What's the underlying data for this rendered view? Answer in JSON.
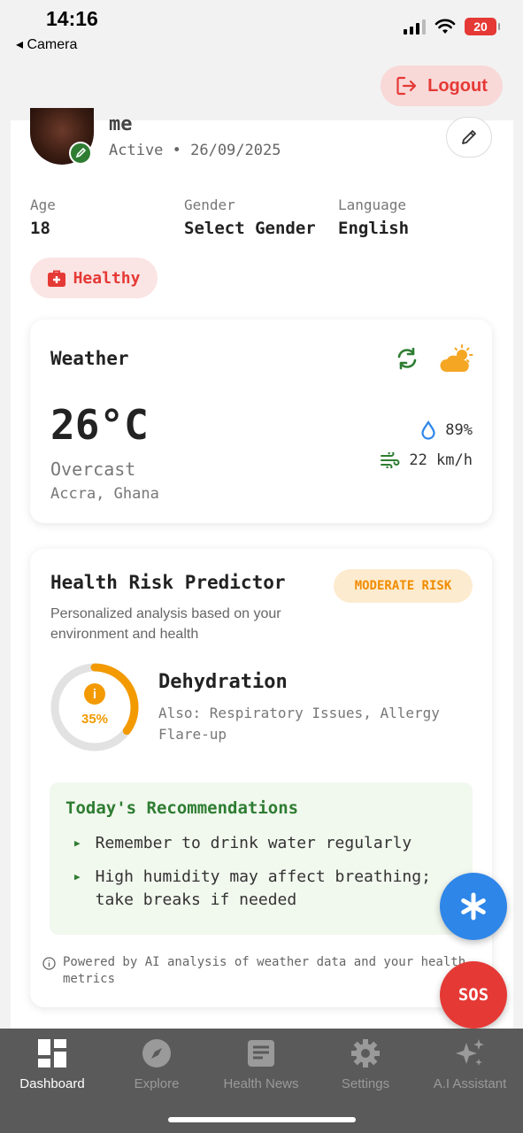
{
  "status_bar": {
    "time": "14:16",
    "back_label": "◂ Camera",
    "battery": "20"
  },
  "header": {
    "logout_label": "Logout"
  },
  "profile": {
    "name": "me",
    "active_line": "Active • 26/09/2025",
    "info": [
      {
        "label": "Age",
        "value": "18"
      },
      {
        "label": "Gender",
        "value": "Select Gender"
      },
      {
        "label": "Language",
        "value": "English"
      }
    ],
    "health_status": "Healthy"
  },
  "weather": {
    "title": "Weather",
    "temperature": "26°C",
    "condition": "Overcast",
    "location": "Accra, Ghana",
    "humidity": "89%",
    "wind": "22 km/h"
  },
  "risk": {
    "title": "Health Risk Predictor",
    "badge": "MODERATE RISK",
    "subtitle": "Personalized analysis based on your environment and health",
    "percent": "35%",
    "percent_value": 35,
    "main_risk": "Dehydration",
    "also": "Also: Respiratory Issues, Allergy Flare-up",
    "recommendations_title": "Today's Recommendations",
    "recommendations": [
      "Remember to drink water regularly",
      "High humidity may affect breathing; take breaks if needed"
    ],
    "powered_by": "Powered by AI analysis of weather data and your health metrics"
  },
  "fab": {
    "sos_label": "SOS"
  },
  "nav": {
    "items": [
      {
        "label": "Dashboard",
        "icon": "dashboard-icon"
      },
      {
        "label": "Explore",
        "icon": "compass-icon"
      },
      {
        "label": "Health News",
        "icon": "news-icon"
      },
      {
        "label": "Settings",
        "icon": "gear-icon"
      },
      {
        "label": "A.I Assistant",
        "icon": "sparkles-icon"
      }
    ]
  },
  "colors": {
    "accent_red": "#e53935",
    "accent_green": "#2e7d32",
    "accent_orange": "#f29a00",
    "fab_blue": "#2e86e8"
  }
}
